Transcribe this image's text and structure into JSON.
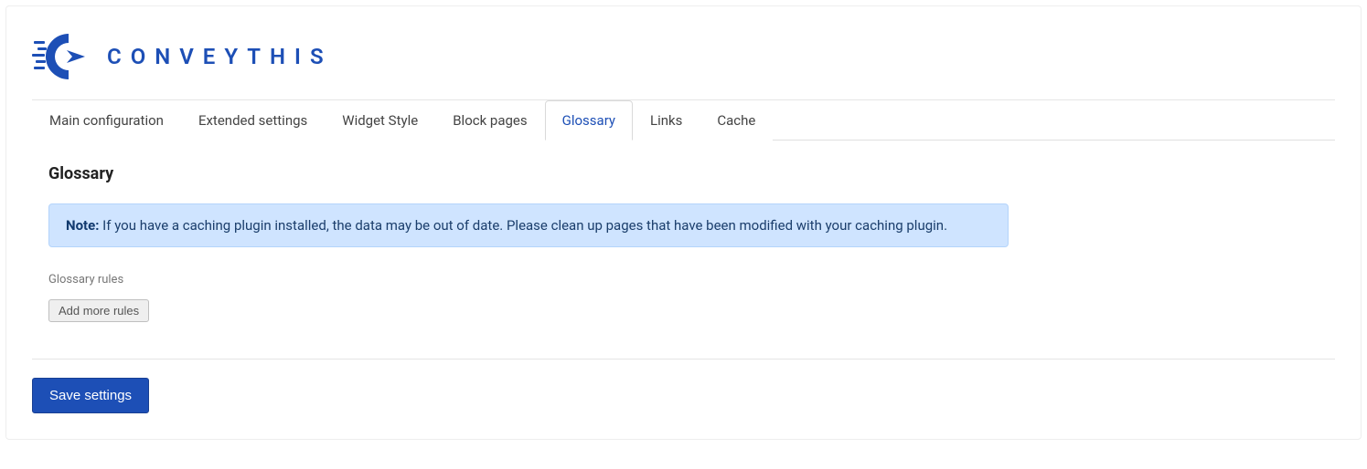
{
  "logo": {
    "text": "CONVEYTHIS"
  },
  "tabs": [
    {
      "label": "Main configuration",
      "active": false
    },
    {
      "label": "Extended settings",
      "active": false
    },
    {
      "label": "Widget Style",
      "active": false
    },
    {
      "label": "Block pages",
      "active": false
    },
    {
      "label": "Glossary",
      "active": true
    },
    {
      "label": "Links",
      "active": false
    },
    {
      "label": "Cache",
      "active": false
    }
  ],
  "section": {
    "title": "Glossary",
    "note_label": "Note:",
    "note_text": " If you have a caching plugin installed, the data may be out of date. Please clean up pages that have been modified with your caching plugin.",
    "rules_label": "Glossary rules",
    "add_button": "Add more rules",
    "save_button": "Save settings"
  },
  "colors": {
    "brand": "#1d4fb6",
    "note_bg": "#cfe4ff"
  }
}
